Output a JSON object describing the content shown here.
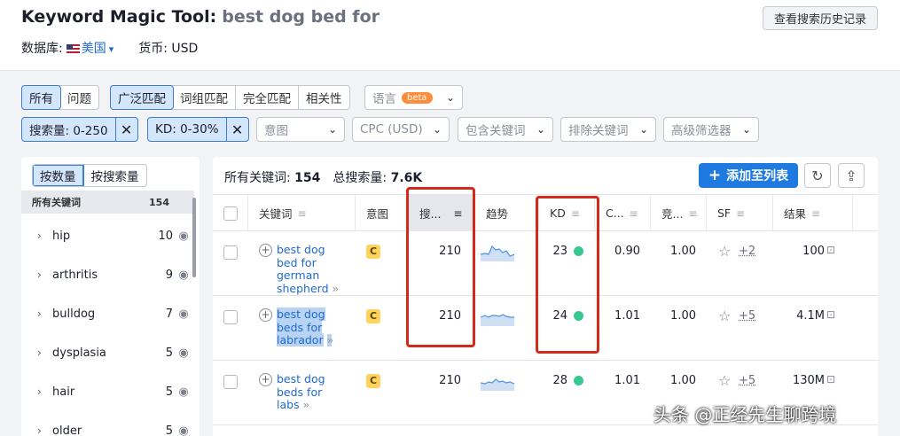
{
  "header": {
    "tool_name": "Keyword Magic Tool:",
    "query": "best dog bed for",
    "history_button": "查看搜索历史记录",
    "database_label": "数据库:",
    "database_value": "美国",
    "currency": "货币: USD"
  },
  "filters": {
    "scope_tabs": [
      {
        "label": "所有",
        "active": true
      },
      {
        "label": "问题",
        "active": false
      }
    ],
    "match_tabs": [
      {
        "label": "广泛匹配",
        "active": true
      },
      {
        "label": "词组匹配",
        "active": false
      },
      {
        "label": "完全匹配",
        "active": false
      },
      {
        "label": "相关性",
        "active": false
      }
    ],
    "language": {
      "label": "语言",
      "badge": "beta"
    },
    "active_chips": [
      {
        "label": "搜索量: 0-250"
      },
      {
        "label": "KD: 0-30%"
      }
    ],
    "dropdowns": [
      "意图",
      "CPC (USD)",
      "包含关键词",
      "排除关键词",
      "高级筛选器"
    ]
  },
  "sidebar": {
    "toggle": [
      {
        "label": "按数量",
        "active": true
      },
      {
        "label": "按搜索量",
        "active": false
      }
    ],
    "all_label": "所有关键词",
    "all_count": "154",
    "items": [
      {
        "label": "hip",
        "count": "10"
      },
      {
        "label": "arthritis",
        "count": "9"
      },
      {
        "label": "bulldog",
        "count": "7"
      },
      {
        "label": "dysplasia",
        "count": "5"
      },
      {
        "label": "hair",
        "count": "5"
      },
      {
        "label": "older",
        "count": "5"
      }
    ]
  },
  "summary": {
    "all_label": "所有关键词:",
    "all_value": "154",
    "volume_label": "总搜索量:",
    "volume_value": "7.6K",
    "add_button": "添加至列表"
  },
  "table": {
    "headers": {
      "keyword": "关键词",
      "intent": "意图",
      "volume": "搜...",
      "trend": "趋势",
      "kd": "KD",
      "cpc": "C...",
      "competition": "竞...",
      "sf": "SF",
      "results": "结果"
    },
    "rows": [
      {
        "keyword": "best dog bed for german shepherd",
        "intent": "C",
        "volume": "210",
        "kd": "23",
        "cpc": "0.90",
        "competition": "1.00",
        "sf": "+2",
        "results": "100",
        "highlighted": false
      },
      {
        "keyword": "best dog beds for labrador",
        "intent": "C",
        "volume": "210",
        "kd": "24",
        "cpc": "1.01",
        "competition": "1.00",
        "sf": "+5",
        "results": "4.1M",
        "highlighted": true
      },
      {
        "keyword": "best dog beds for labs",
        "intent": "C",
        "volume": "210",
        "kd": "28",
        "cpc": "1.01",
        "competition": "1.00",
        "sf": "+5",
        "results": "130M",
        "highlighted": false
      }
    ]
  },
  "colors": {
    "accent": "#1f7ae0",
    "kd_easy": "#38c790",
    "intent_commercial": "#ffd35c",
    "annotation_red": "#d42a1c"
  },
  "watermark": "头条 @正经先生聊跨境"
}
